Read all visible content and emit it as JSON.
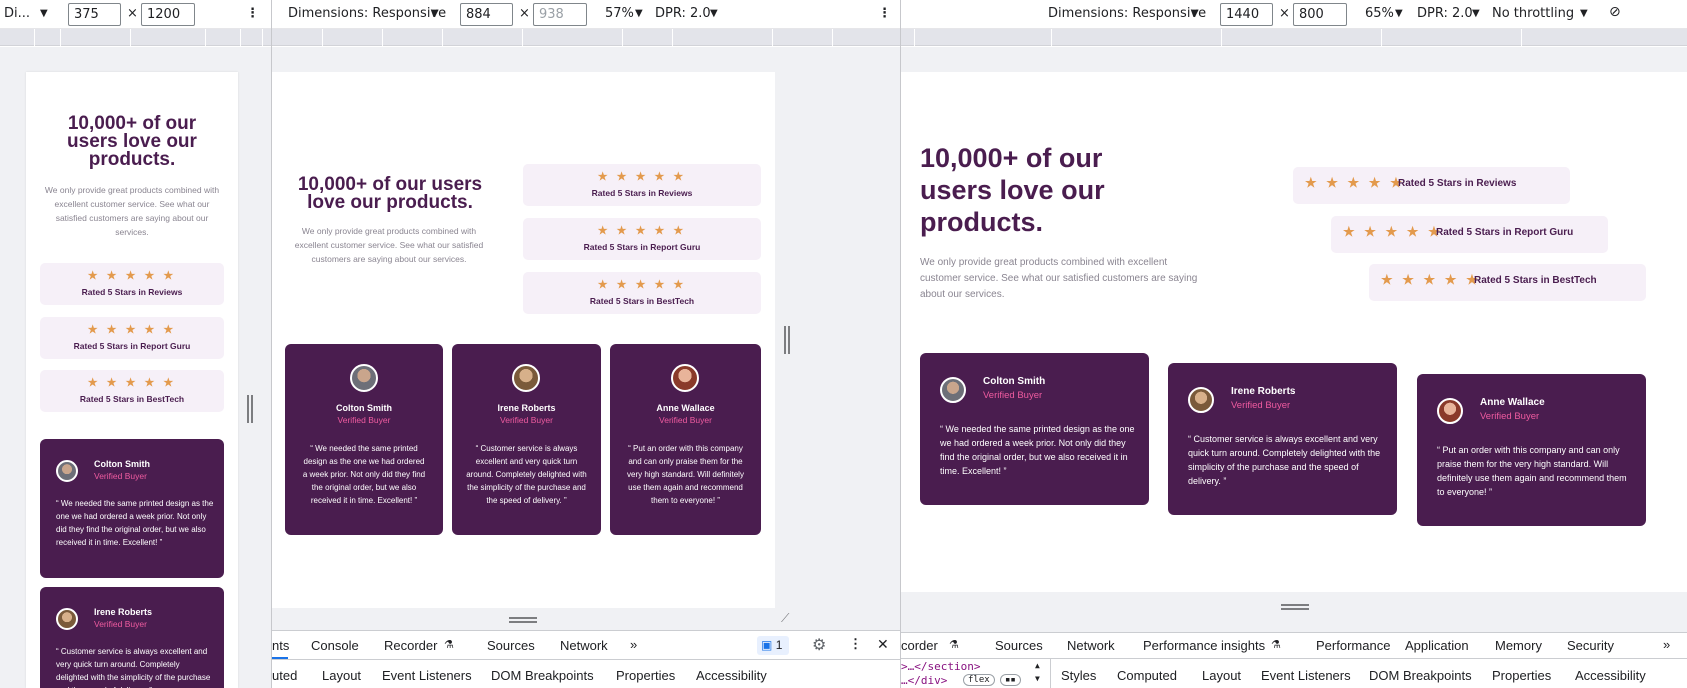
{
  "colors": {
    "brand": "#4a1d4f",
    "accent": "#ef5ba0",
    "star": "#e39a4d",
    "rating_bg": "#f6f0f8"
  },
  "content": {
    "heading": "10,000+ of our users love our products.",
    "subtext": "We only provide great products combined with excellent customer service. See what our satisfied customers are saying about our services.",
    "stars": "★ ★ ★ ★ ★",
    "ratings": [
      "Rated 5 Stars in Reviews",
      "Rated 5 Stars in Report Guru",
      "Rated 5 Stars in BestTech"
    ],
    "testimonials": [
      {
        "name": "Colton Smith",
        "role": "Verified Buyer",
        "quote": "“ We needed the same printed design as the one we had ordered a week prior. Not only did they find the original order, but we also received it in time. Excellent! ”",
        "avatar": "avatar-colton"
      },
      {
        "name": "Irene Roberts",
        "role": "Verified Buyer",
        "quote": "“ Customer service is always excellent and very quick turn around. Completely delighted with the simplicity of the purchase and the speed of delivery. ”",
        "avatar": "avatar-irene"
      },
      {
        "name": "Anne Wallace",
        "role": "Verified Buyer",
        "quote": "“ Put an order with this company and can only praise them for the very high standard. Will definitely use them again and recommend them to everyone! ”",
        "avatar": "avatar-anne"
      }
    ]
  },
  "left_window": {
    "device": "Di...",
    "width": "375",
    "height": "1200",
    "times": "×"
  },
  "mid_window": {
    "dimensions": "Dimensions: Responsive",
    "width": "884",
    "height": "938",
    "times": "×",
    "zoom": "57%",
    "dpr": "DPR: 2.0",
    "devtools_tabs": [
      "nts",
      "Console",
      "Recorder",
      "Sources",
      "Network",
      "»"
    ],
    "issues_count": "1",
    "panel_tabs": [
      "uted",
      "Layout",
      "Event Listeners",
      "DOM Breakpoints",
      "Properties",
      "Accessibility"
    ]
  },
  "right_window": {
    "dimensions": "Dimensions: Responsive",
    "width": "1440",
    "height": "800",
    "times": "×",
    "zoom": "65%",
    "dpr": "DPR: 2.0",
    "throttling": "No throttling",
    "devtools_tabs": [
      "corder",
      "Sources",
      "Network",
      "Performance insights",
      "Performance",
      "Application",
      "Memory",
      "Security",
      "»"
    ],
    "elements_snippet_1": ">…</section>",
    "elements_snippet_2": "…</div>",
    "flex_badge": "flex",
    "panel_tabs": [
      "Styles",
      "Computed",
      "Layout",
      "Event Listeners",
      "DOM Breakpoints",
      "Properties",
      "Accessibility"
    ]
  }
}
